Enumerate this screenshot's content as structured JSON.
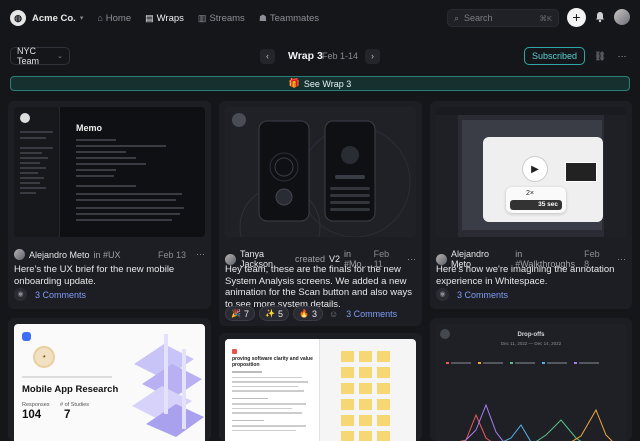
{
  "topbar": {
    "org_name": "Acme Co.",
    "nav": [
      {
        "label": "Home",
        "icon": "home-icon",
        "active": false
      },
      {
        "label": "Wraps",
        "icon": "wraps-icon",
        "active": true
      },
      {
        "label": "Streams",
        "icon": "streams-icon",
        "active": false
      },
      {
        "label": "Teammates",
        "icon": "teammates-icon",
        "active": false
      }
    ],
    "search_placeholder": "Search",
    "search_shortcut": "⌘K"
  },
  "subheader": {
    "channel": "NYC Team",
    "wrap_title": "Wrap 3",
    "wrap_dates": "Feb 1-14",
    "subscribed_label": "Subscribed"
  },
  "banner": {
    "label": "See Wrap 3"
  },
  "cards": [
    {
      "author": "Alejandro Meto",
      "context": "in #UX",
      "date": "Feb 13",
      "body": "Here's the UX brief for the new mobile onboarding update.",
      "comments": "3 Comments",
      "thumb_title": "Memo"
    },
    {
      "author": "Tanya Jackson",
      "context_prefix": "created",
      "context_link": "V2",
      "context_suffix": "in #Mo...",
      "date": "Feb 11",
      "body": "Hey team, these are the finals for the new System Analysis screens. We added a new animation for the Scan button and also ways to see more system details.",
      "reactions": [
        {
          "emoji": "🎉",
          "count": "7"
        },
        {
          "emoji": "✨",
          "count": "5"
        },
        {
          "emoji": "🔥",
          "count": "3"
        }
      ],
      "comments": "3 Comments"
    },
    {
      "author": "Alejandro Meto",
      "context": "in #Walkthroughs",
      "date": "Feb 8",
      "body": "Here's how we're imagining the annotation experience in Whitespace.",
      "comments": "3 Comments",
      "thumb_badge": "35 sec",
      "thumb_speed": "2×"
    },
    {
      "thumb_title": "Mobile App Research",
      "stat1_label": "Responses",
      "stat1_value": "104",
      "stat2_label": "# of Studies",
      "stat2_value": "7"
    },
    {
      "thumb_doc_title": "proving software clarity and value proposition"
    },
    {
      "thumb_title": "Drop-offs",
      "thumb_dates": "Dec 11, 2022 — Dec 14, 2022"
    }
  ],
  "colors": {
    "accent": "#57d1cf",
    "link": "#7f9cf5",
    "background": "#15161a",
    "card": "#1d1e23"
  }
}
